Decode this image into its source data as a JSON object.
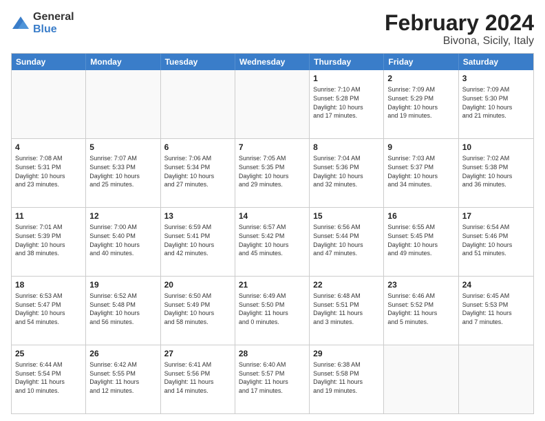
{
  "logo": {
    "general": "General",
    "blue": "Blue"
  },
  "header": {
    "title": "February 2024",
    "subtitle": "Bivona, Sicily, Italy"
  },
  "weekdays": [
    "Sunday",
    "Monday",
    "Tuesday",
    "Wednesday",
    "Thursday",
    "Friday",
    "Saturday"
  ],
  "weeks": [
    [
      {
        "day": "",
        "info": ""
      },
      {
        "day": "",
        "info": ""
      },
      {
        "day": "",
        "info": ""
      },
      {
        "day": "",
        "info": ""
      },
      {
        "day": "1",
        "info": "Sunrise: 7:10 AM\nSunset: 5:28 PM\nDaylight: 10 hours\nand 17 minutes."
      },
      {
        "day": "2",
        "info": "Sunrise: 7:09 AM\nSunset: 5:29 PM\nDaylight: 10 hours\nand 19 minutes."
      },
      {
        "day": "3",
        "info": "Sunrise: 7:09 AM\nSunset: 5:30 PM\nDaylight: 10 hours\nand 21 minutes."
      }
    ],
    [
      {
        "day": "4",
        "info": "Sunrise: 7:08 AM\nSunset: 5:31 PM\nDaylight: 10 hours\nand 23 minutes."
      },
      {
        "day": "5",
        "info": "Sunrise: 7:07 AM\nSunset: 5:33 PM\nDaylight: 10 hours\nand 25 minutes."
      },
      {
        "day": "6",
        "info": "Sunrise: 7:06 AM\nSunset: 5:34 PM\nDaylight: 10 hours\nand 27 minutes."
      },
      {
        "day": "7",
        "info": "Sunrise: 7:05 AM\nSunset: 5:35 PM\nDaylight: 10 hours\nand 29 minutes."
      },
      {
        "day": "8",
        "info": "Sunrise: 7:04 AM\nSunset: 5:36 PM\nDaylight: 10 hours\nand 32 minutes."
      },
      {
        "day": "9",
        "info": "Sunrise: 7:03 AM\nSunset: 5:37 PM\nDaylight: 10 hours\nand 34 minutes."
      },
      {
        "day": "10",
        "info": "Sunrise: 7:02 AM\nSunset: 5:38 PM\nDaylight: 10 hours\nand 36 minutes."
      }
    ],
    [
      {
        "day": "11",
        "info": "Sunrise: 7:01 AM\nSunset: 5:39 PM\nDaylight: 10 hours\nand 38 minutes."
      },
      {
        "day": "12",
        "info": "Sunrise: 7:00 AM\nSunset: 5:40 PM\nDaylight: 10 hours\nand 40 minutes."
      },
      {
        "day": "13",
        "info": "Sunrise: 6:59 AM\nSunset: 5:41 PM\nDaylight: 10 hours\nand 42 minutes."
      },
      {
        "day": "14",
        "info": "Sunrise: 6:57 AM\nSunset: 5:42 PM\nDaylight: 10 hours\nand 45 minutes."
      },
      {
        "day": "15",
        "info": "Sunrise: 6:56 AM\nSunset: 5:44 PM\nDaylight: 10 hours\nand 47 minutes."
      },
      {
        "day": "16",
        "info": "Sunrise: 6:55 AM\nSunset: 5:45 PM\nDaylight: 10 hours\nand 49 minutes."
      },
      {
        "day": "17",
        "info": "Sunrise: 6:54 AM\nSunset: 5:46 PM\nDaylight: 10 hours\nand 51 minutes."
      }
    ],
    [
      {
        "day": "18",
        "info": "Sunrise: 6:53 AM\nSunset: 5:47 PM\nDaylight: 10 hours\nand 54 minutes."
      },
      {
        "day": "19",
        "info": "Sunrise: 6:52 AM\nSunset: 5:48 PM\nDaylight: 10 hours\nand 56 minutes."
      },
      {
        "day": "20",
        "info": "Sunrise: 6:50 AM\nSunset: 5:49 PM\nDaylight: 10 hours\nand 58 minutes."
      },
      {
        "day": "21",
        "info": "Sunrise: 6:49 AM\nSunset: 5:50 PM\nDaylight: 11 hours\nand 0 minutes."
      },
      {
        "day": "22",
        "info": "Sunrise: 6:48 AM\nSunset: 5:51 PM\nDaylight: 11 hours\nand 3 minutes."
      },
      {
        "day": "23",
        "info": "Sunrise: 6:46 AM\nSunset: 5:52 PM\nDaylight: 11 hours\nand 5 minutes."
      },
      {
        "day": "24",
        "info": "Sunrise: 6:45 AM\nSunset: 5:53 PM\nDaylight: 11 hours\nand 7 minutes."
      }
    ],
    [
      {
        "day": "25",
        "info": "Sunrise: 6:44 AM\nSunset: 5:54 PM\nDaylight: 11 hours\nand 10 minutes."
      },
      {
        "day": "26",
        "info": "Sunrise: 6:42 AM\nSunset: 5:55 PM\nDaylight: 11 hours\nand 12 minutes."
      },
      {
        "day": "27",
        "info": "Sunrise: 6:41 AM\nSunset: 5:56 PM\nDaylight: 11 hours\nand 14 minutes."
      },
      {
        "day": "28",
        "info": "Sunrise: 6:40 AM\nSunset: 5:57 PM\nDaylight: 11 hours\nand 17 minutes."
      },
      {
        "day": "29",
        "info": "Sunrise: 6:38 AM\nSunset: 5:58 PM\nDaylight: 11 hours\nand 19 minutes."
      },
      {
        "day": "",
        "info": ""
      },
      {
        "day": "",
        "info": ""
      }
    ]
  ]
}
